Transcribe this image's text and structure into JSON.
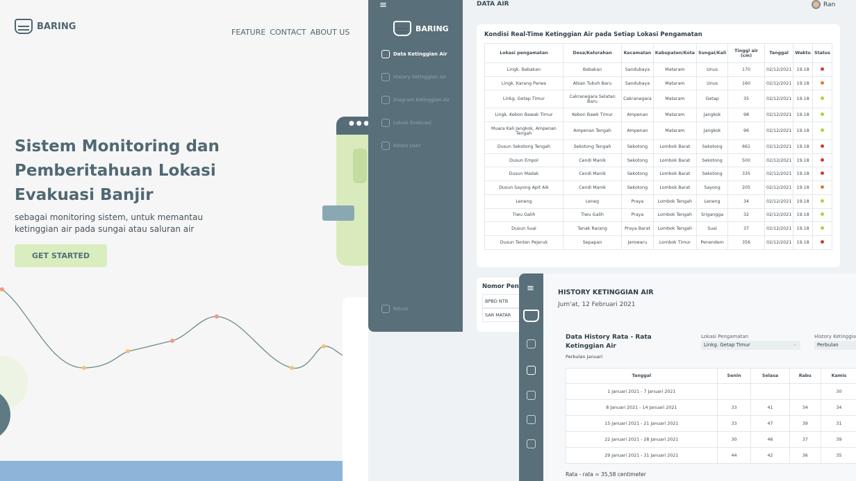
{
  "landing": {
    "brand": "BARING",
    "nav": [
      "FEATURE",
      "CONTACT",
      "ABOUT US"
    ],
    "title": "Sistem Monitoring dan Pemberitahuan Lokasi Evakuasi Banjir",
    "desc": "sebagai monitoring sistem, untuk memantau ketinggian air pada sungai atau saluran air",
    "cta": "GET STARTED"
  },
  "dash": {
    "brand": "BARING",
    "menu": [
      "Data Ketinggian Air",
      "History Ketinggian Air",
      "Diagram Ketinggian Air",
      "Lokasi Evakuasi",
      "Kelola User"
    ],
    "logout": "Keluar",
    "page_title": "DATA AIR",
    "user": "Ran",
    "card_title": "Kondisi Real-Time Ketinggian Air pada Setiap Lokasi Pengamatan",
    "columns": [
      "Lokasi pengamatan",
      "Desa/Kelurahan",
      "Kecamatan",
      "Kabupaten/Kota",
      "Sungai/Kali",
      "Tinggi air (cm)",
      "Tanggal",
      "Waktu",
      "Status"
    ],
    "rows": [
      [
        "Lingk. Babakan",
        "Babakan",
        "Sandubaya",
        "Mataram",
        "Unus",
        "170",
        "02/12/2021",
        "19.18",
        "#d23a2f"
      ],
      [
        "Lingk. Karang Parwa",
        "Abian Tubuh Baru",
        "Sandubaya",
        "Mataram",
        "Unus",
        "160",
        "02/12/2021",
        "19.18",
        "#e37a33"
      ],
      [
        "Linkg. Getap Timur",
        "Cakranegara Selatan Baru",
        "Cakranegara",
        "Mataram",
        "Getap",
        "35",
        "02/12/2021",
        "19.18",
        "#a8d44a"
      ],
      [
        "Lingk. Kebon Bawak Timur",
        "Kebon Bawk Timur",
        "Ampenan",
        "Mataram",
        "Jangkok",
        "98",
        "02/12/2021",
        "19.18",
        "#a8d44a"
      ],
      [
        "Muara Kali Jangkok, Ampenan Tengah",
        "Ampenan Tengah",
        "Ampenan",
        "Mataram",
        "Jangkok",
        "96",
        "02/12/2021",
        "19.18",
        "#a8d44a"
      ],
      [
        "Dusun Sekotong Tengah",
        "Sekotong Tengah",
        "Sekotong",
        "Lombok Barat",
        "Sekotong",
        "661",
        "02/12/2021",
        "19.18",
        "#d23a2f"
      ],
      [
        "Dusun Empol",
        "Cendi Manik",
        "Sekotong",
        "Lombok Barat",
        "Sekotong",
        "500",
        "02/12/2021",
        "19.18",
        "#d23a2f"
      ],
      [
        "Dusun Madak",
        "Cendi Manik",
        "Sekotong",
        "Lombok Barat",
        "Sekotong",
        "335",
        "02/12/2021",
        "19.18",
        "#d23a2f"
      ],
      [
        "Dusun Sayong Apit Aik",
        "Cendi Manik",
        "Sekotong",
        "Lombok Barat",
        "Sayong",
        "205",
        "02/12/2021",
        "19.18",
        "#e37a33"
      ],
      [
        "Leneng",
        "Leneg",
        "Praya",
        "Lombok Tengah",
        "Leneng",
        "34",
        "02/12/2021",
        "19.18",
        "#a8d44a"
      ],
      [
        "Tiwu Galih",
        "Tiwu Galih",
        "Praya",
        "Lombok Tengah",
        "Srigangga",
        "32",
        "02/12/2021",
        "19.18",
        "#a8d44a"
      ],
      [
        "Dusun Suai",
        "Tanak Rarang",
        "Praya Barat",
        "Lombok Tengah",
        "Suai",
        "37",
        "02/12/2021",
        "19.18",
        "#a8d44a"
      ],
      [
        "Dusun Tenten Pejeruk",
        "Sepapan",
        "Jerowaru",
        "Lombok Timur",
        "Penendem",
        "356",
        "02/12/2021",
        "19.18",
        "#d23a2f"
      ]
    ],
    "phone_card": {
      "title": "Nomor Pen",
      "rows": [
        "BPBD NTB",
        "SAR MATAR"
      ]
    }
  },
  "hist": {
    "title": "HISTORY KETINGGIAN AIR",
    "date": "Jum'at, 12 Februari 2021",
    "card_title": "Data History Rata - Rata Ketinggian Air",
    "card_sub": "Perbulan Januari",
    "lokasi_label": "Lokasi Pengamatan",
    "lokasi_value": "Linkg. Getap Timur",
    "history_label": "History Ketinggia",
    "history_value": "Perbulan",
    "columns": [
      "Tanggal",
      "Senin",
      "Selasa",
      "Rabu",
      "Kamis"
    ],
    "rows": [
      [
        "1 Januari 2021 - 7 Januari 2021",
        "",
        "",
        "",
        "30"
      ],
      [
        "8 Januari 2021 - 14 Januari 2021",
        "33",
        "41",
        "34",
        "34"
      ],
      [
        "15 Januari 2021 - 21 Januari 2021",
        "33",
        "47",
        "39",
        "31"
      ],
      [
        "22 Januari 2021 - 28 Januari 2021",
        "30",
        "46",
        "37",
        "39"
      ],
      [
        "29 Januari 2021 - 31 Januari 2021",
        "44",
        "42",
        "36",
        "35"
      ]
    ],
    "avg": "Rata - rata = 35,58 centimeter"
  }
}
